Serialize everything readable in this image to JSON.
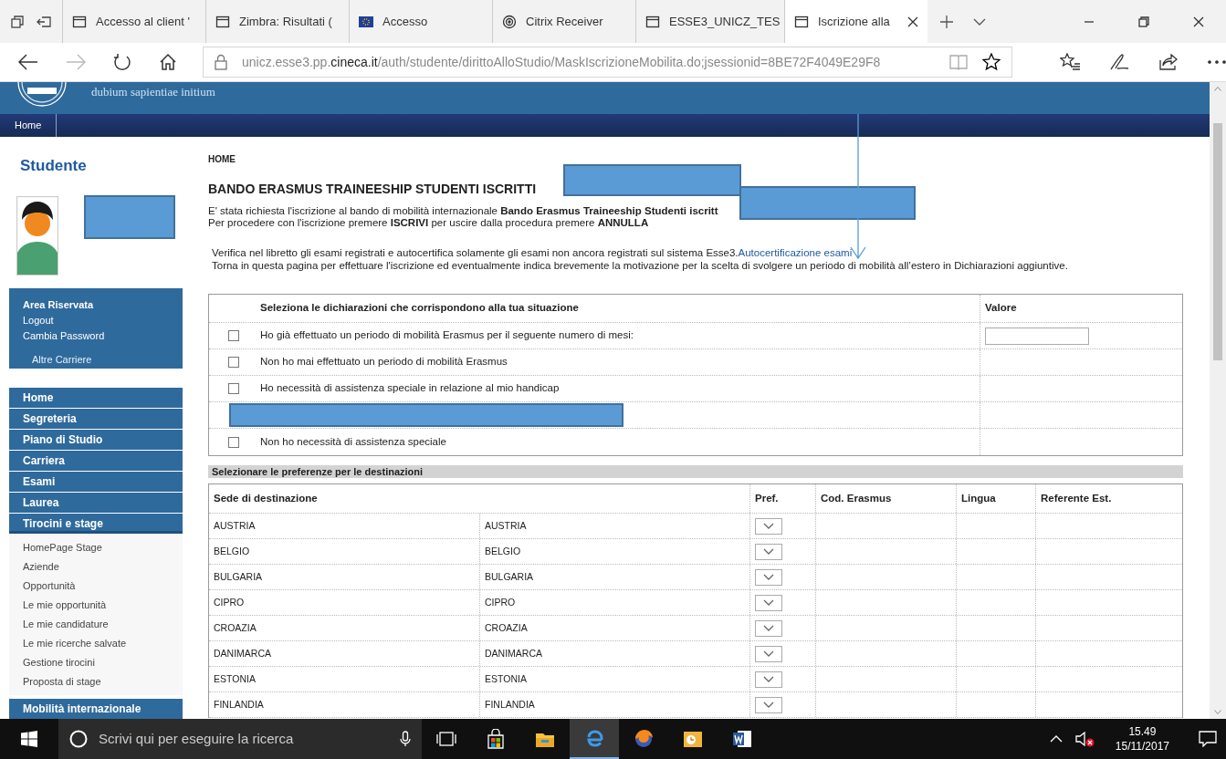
{
  "browser": {
    "tabs": [
      {
        "kind": "page",
        "title": "Accesso al client '",
        "selected": false
      },
      {
        "kind": "page",
        "title": "Zimbra: Risultati (",
        "selected": false
      },
      {
        "kind": "flag",
        "title": "Accesso",
        "selected": false
      },
      {
        "kind": "citrix",
        "title": "Citrix Receiver",
        "selected": false
      },
      {
        "kind": "page",
        "title": "ESSE3_UNICZ_TES",
        "selected": false
      },
      {
        "kind": "page",
        "title": "Iscrizione alla",
        "selected": true
      }
    ],
    "url": {
      "host_start": "unicz.esse3.pp.",
      "domain": "cineca.it",
      "path": "/auth/studente/dirittoAlloStudio/MaskIscrizioneMobilita.do;jsessionid=8BE72F4049E29F8"
    }
  },
  "site_header": {
    "motto": "dubium sapientiae initium",
    "nav": [
      "Home"
    ]
  },
  "sidebar": {
    "title": "Studente",
    "account": [
      "Area Riservata",
      "Logout",
      "Cambia Password",
      "Altre Carriere"
    ],
    "menu": [
      {
        "label": "Home",
        "expanded": false
      },
      {
        "label": "Segreteria",
        "expanded": false
      },
      {
        "label": "Piano di Studio",
        "expanded": false
      },
      {
        "label": "Carriera",
        "expanded": false
      },
      {
        "label": "Esami",
        "expanded": false
      },
      {
        "label": "Laurea",
        "expanded": false
      },
      {
        "label": "Tirocini e stage",
        "expanded": true,
        "children": [
          "HomePage Stage",
          "Aziende",
          "Opportunità",
          "Le mie opportunità",
          "Le mie candidature",
          "Le mie ricerche salvate",
          "Gestione tirocini",
          "Proposta di stage"
        ]
      },
      {
        "label": "Mobilità internazionale",
        "expanded": false
      }
    ]
  },
  "main": {
    "breadcrumb": "HOME",
    "title": "BANDO ERASMUS TRAINEESHIP STUDENTI ISCRITTI",
    "intro": [
      "E' stata richiesta l'iscrizione al bando di mobilità  internazionale **Bando Erasmus Traineeship Studenti iscritt**",
      "Per procedere con l'iscrizione premere **ISCRIVI** per uscire dalla procedura premere **ANNULLA**"
    ],
    "notice": {
      "text": "Verifica nel libretto gli esami registrati e autocertifica solamente gli esami non ancora registrati sul sistema Esse3.",
      "link": "Autocertificazione esami",
      "text_2": "Torna in questa pagina per effettuare l'iscrizione ed eventualmente indica brevemente la motivazione per la scelta di svolgere un periodo di mobilità all’estero in Dichiarazioni aggiuntive."
    },
    "declarations": {
      "columns": [
        "Seleziona le dichiarazioni che corrispondono alla tua situazione",
        "Valore"
      ],
      "rows": [
        {
          "kind": "check",
          "label": "Ho già effettuato un periodo di mobilità Erasmus per il seguente numero di mesi:",
          "checked": false,
          "has_value_field": true
        },
        {
          "kind": "check",
          "label": "Non ho mai effettuato un periodo di mobilità Erasmus",
          "checked": false,
          "has_value_field": false
        },
        {
          "kind": "check",
          "label": "Ho necessità di assistenza speciale in relazione al mio handicap",
          "checked": false,
          "has_value_field": false
        },
        {
          "kind": "redacted"
        },
        {
          "kind": "check",
          "label": "Non ho necessità di assistenza speciale",
          "checked": false,
          "has_value_field": false
        }
      ]
    },
    "destinations": {
      "section_title": "Selezionare le preferenze per le destinazioni",
      "columns": [
        "Sede di destinazione",
        "Pref.",
        "Cod. Erasmus",
        "Lingua",
        "Referente Est."
      ],
      "rows": [
        {
          "sede": "AUSTRIA",
          "column_2": "AUSTRIA"
        },
        {
          "sede": "BELGIO",
          "column_2": "BELGIO"
        },
        {
          "sede": "BULGARIA",
          "column_2": "BULGARIA"
        },
        {
          "sede": "CIPRO",
          "column_2": "CIPRO"
        },
        {
          "sede": "CROAZIA",
          "column_2": "CROAZIA"
        },
        {
          "sede": "DANIMARCA",
          "column_2": "DANIMARCA"
        },
        {
          "sede": "ESTONIA",
          "column_2": "ESTONIA"
        },
        {
          "sede": "FINLANDIA",
          "column_2": "FINLANDIA"
        }
      ]
    }
  },
  "taskbar": {
    "search_placeholder": "Scrivi qui per eseguire la ricerca",
    "time": "15.49",
    "date": "15/11/2017"
  }
}
